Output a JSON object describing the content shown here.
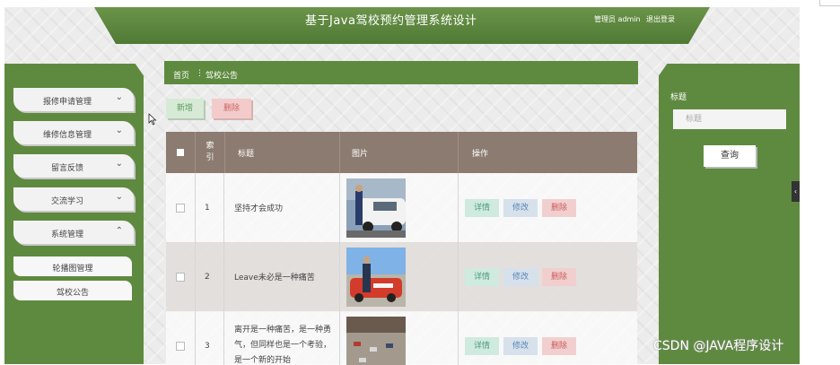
{
  "header": {
    "title": "基于Java驾校预约管理系统设计",
    "user": "管理员 admin",
    "logout": "退出登录"
  },
  "sidebar": {
    "items": [
      {
        "label": "报修申请管理",
        "chevron": "chevron-down-icon"
      },
      {
        "label": "维修信息管理",
        "chevron": "chevron-down-icon"
      },
      {
        "label": "留言反馈",
        "chevron": "chevron-down-icon"
      },
      {
        "label": "交流学习",
        "chevron": "chevron-down-icon"
      },
      {
        "label": "系统管理",
        "chevron": "chevron-up-icon"
      }
    ],
    "subitems": [
      {
        "label": "轮播图管理"
      },
      {
        "label": "驾校公告"
      }
    ]
  },
  "breadcrumb": {
    "home": "首页",
    "separator": "⋮",
    "current": "驾校公告"
  },
  "toolbar": {
    "add_label": "新增",
    "delete_label": "删除"
  },
  "table": {
    "headers": {
      "index": "索引",
      "title": "标题",
      "image": "图片",
      "actions": "操作"
    },
    "rows": [
      {
        "index": "1",
        "title": "坚持才会成功",
        "image": "instructor-car-photo"
      },
      {
        "index": "2",
        "title": "Leave未必是一种痛苦",
        "image": "man-by-car-photo"
      },
      {
        "index": "3",
        "title": "离开是一种痛苦，是一种勇气，但同样也是一个考验，是一个新的开始",
        "image": "parking-lot-photo"
      }
    ],
    "actions": {
      "detail": "详情",
      "edit": "修改",
      "delete": "删除"
    }
  },
  "search": {
    "label": "标题",
    "placeholder": "标题",
    "button": "查询"
  },
  "watermark": "CSDN @JAVA程序设计",
  "colors": {
    "header_green": "#5e8a3f",
    "table_header": "#8b7b70",
    "add_button": "#d6ead6",
    "delete_button": "#f3cbcb"
  }
}
